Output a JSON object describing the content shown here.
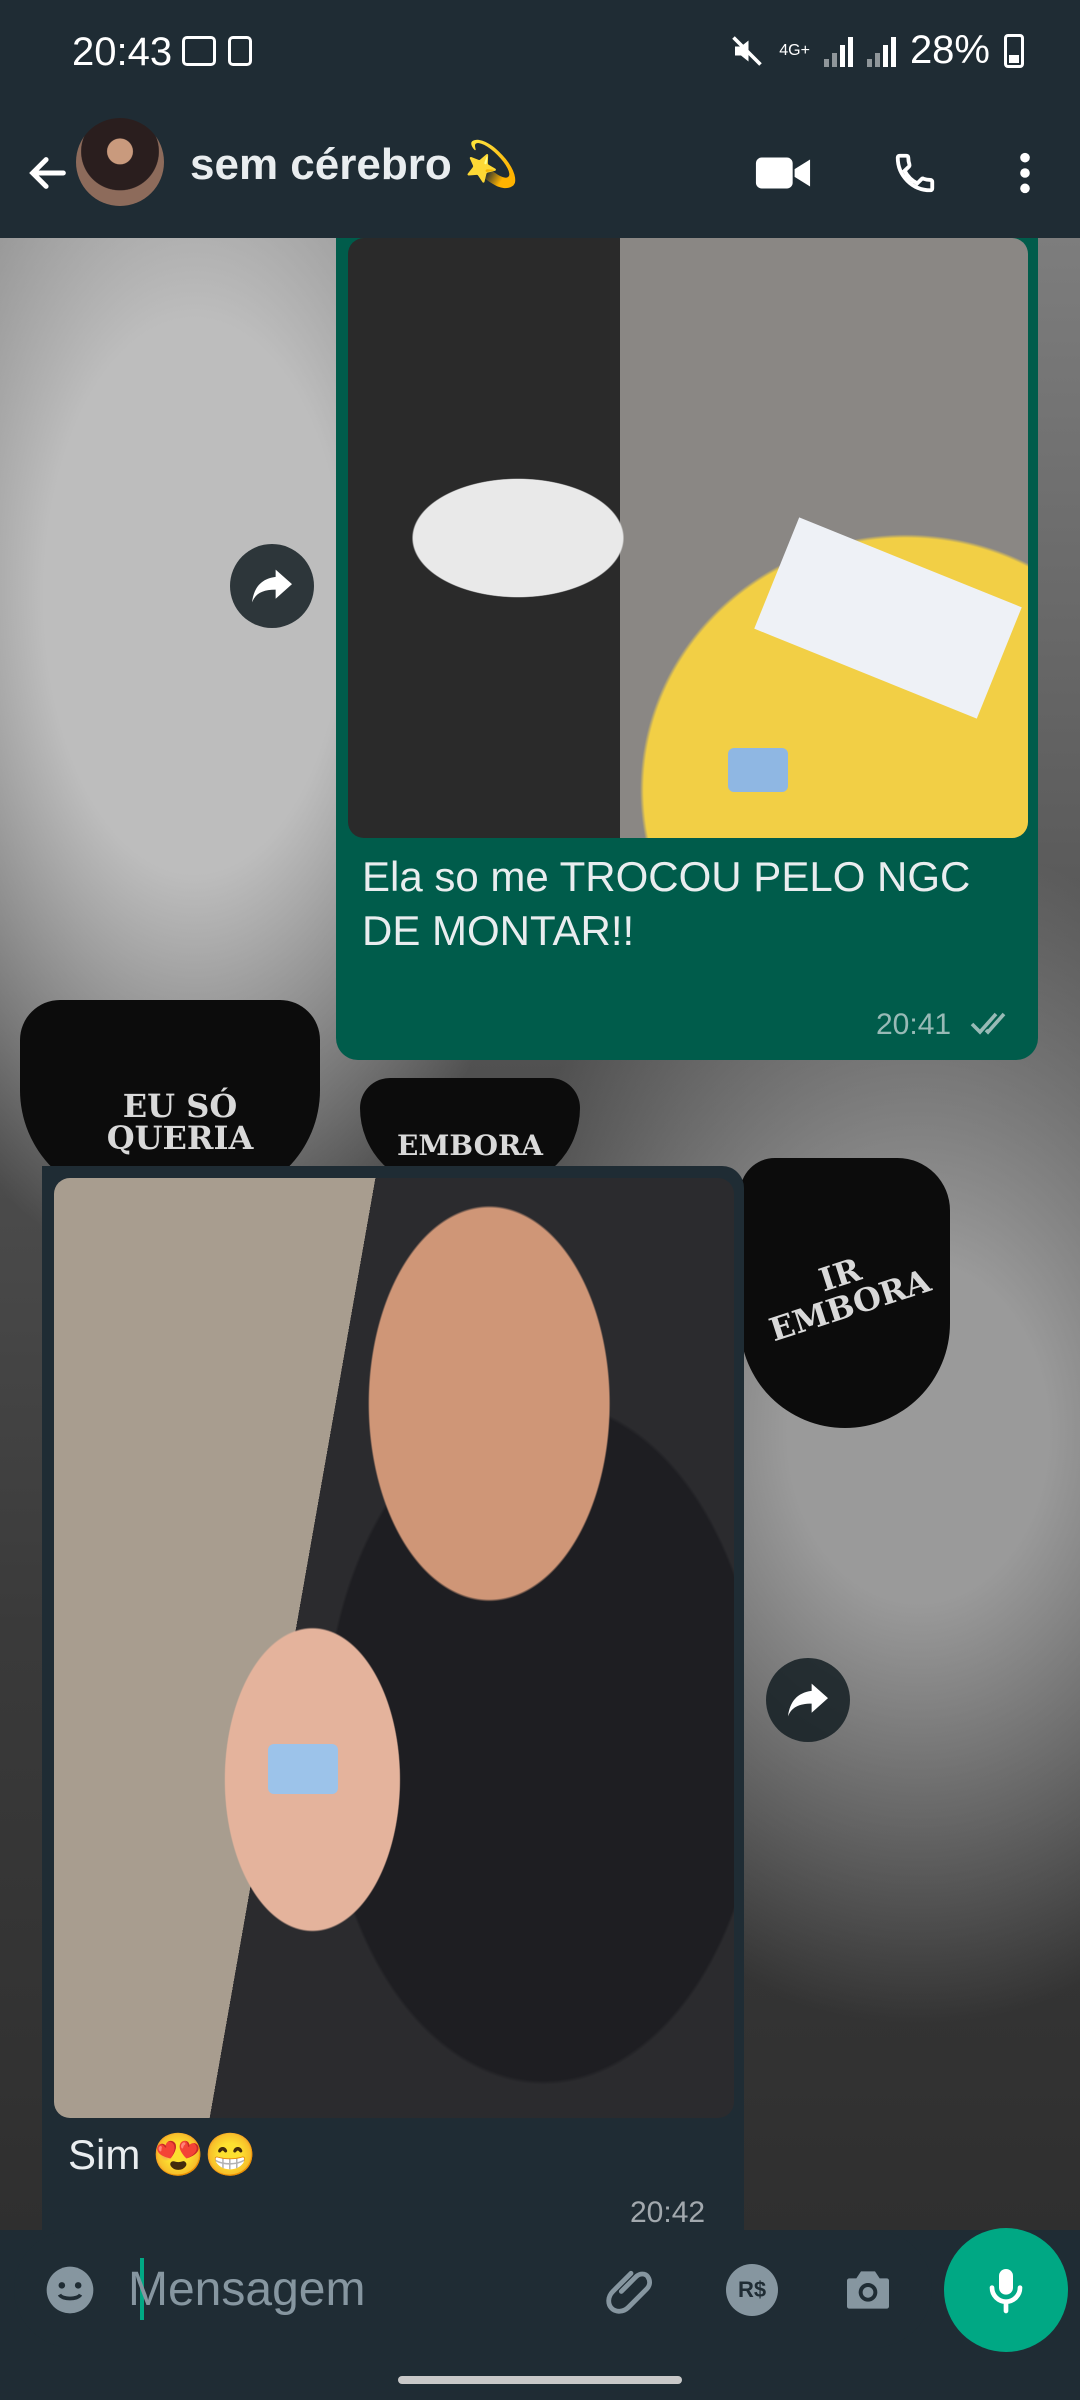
{
  "status": {
    "time": "20:43",
    "network": "4G+",
    "battery": "28%"
  },
  "header": {
    "contact_name": "sem cérebro",
    "contact_emoji": "💫"
  },
  "wallpaper": {
    "text_left": "EU SÓ QUERIA",
    "text_middle": "EMBORA",
    "text_right": "IR EMBORA"
  },
  "messages": [
    {
      "direction": "outgoing",
      "type": "image",
      "caption": "Ela so me TROCOU PELO NGC DE MONTAR!!",
      "time": "20:41",
      "status": "read"
    },
    {
      "direction": "incoming",
      "type": "image",
      "caption": "Sim 😍😁",
      "time": "20:42"
    }
  ],
  "input": {
    "placeholder": "Mensagem"
  },
  "colors": {
    "outgoing_bubble": "#005c4b",
    "incoming_bubble": "#1f2c34",
    "accent": "#00a884",
    "bar": "#1f2c34"
  },
  "icons": [
    "back-arrow-icon",
    "video-call-icon",
    "phone-icon",
    "more-options-icon",
    "forward-icon",
    "double-check-icon",
    "emoji-icon",
    "attach-icon",
    "payment-icon",
    "camera-icon",
    "mic-icon"
  ]
}
